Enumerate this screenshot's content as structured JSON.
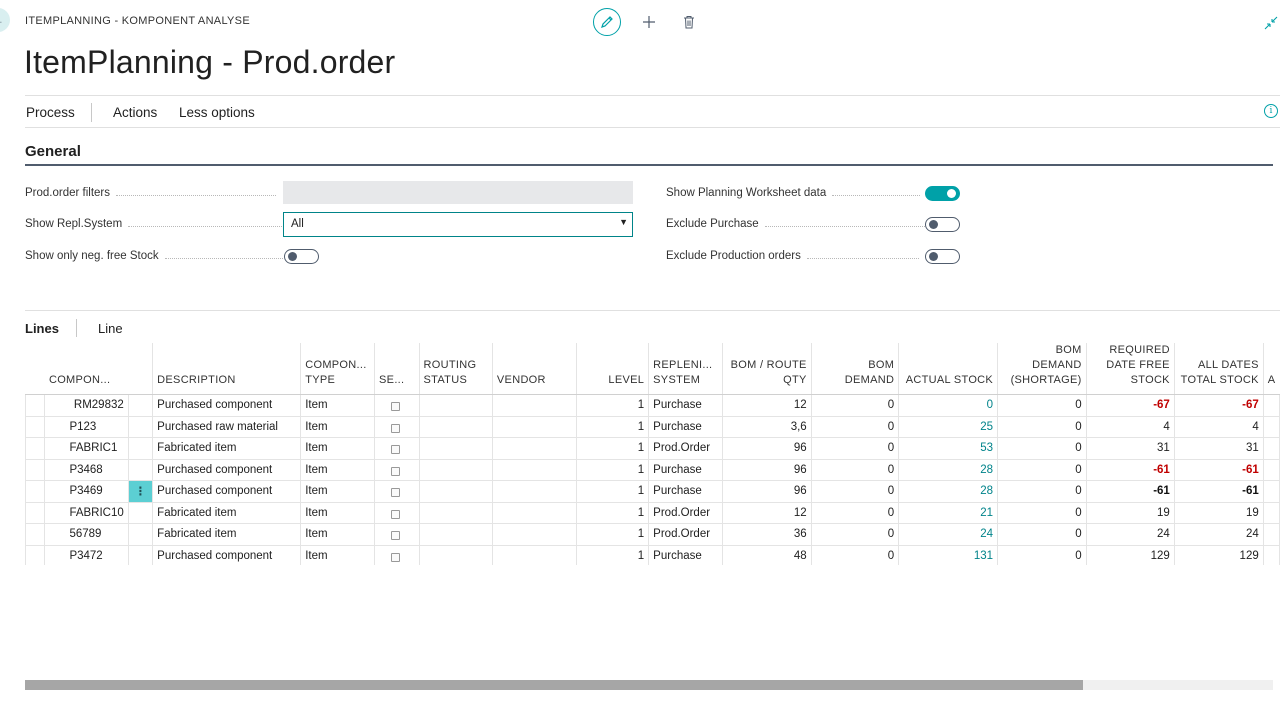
{
  "breadcrumb": "ITEMPLANNING - KOMPONENT ANALYSE",
  "page_title": "ItemPlanning - Prod.order",
  "action_bar": {
    "process": "Process",
    "actions": "Actions",
    "less_options": "Less options"
  },
  "general": {
    "title": "General",
    "prod_order_filters": {
      "label": "Prod.order filters",
      "value": ""
    },
    "show_repl_system": {
      "label": "Show Repl.System",
      "value": "All"
    },
    "show_only_neg_free_stock": {
      "label": "Show only neg. free Stock",
      "on": false
    },
    "show_planning_worksheet_data": {
      "label": "Show Planning Worksheet data",
      "on": true
    },
    "exclude_purchase": {
      "label": "Exclude Purchase",
      "on": false
    },
    "exclude_production_orders": {
      "label": "Exclude Production orders",
      "on": false
    }
  },
  "lines": {
    "tab_lines": "Lines",
    "tab_line": "Line",
    "headers": {
      "component": "COMPON...",
      "description": "DESCRIPTION",
      "component_type_1": "COMPON...",
      "component_type_2": "TYPE",
      "se": "SE...",
      "routing_status_1": "ROUTING",
      "routing_status_2": "STATUS",
      "vendor": "VENDOR",
      "level": "LEVEL",
      "replenishment_1": "REPLENI...",
      "replenishment_2": "SYSTEM",
      "bom_route_qty_1": "BOM / ROUTE",
      "bom_route_qty_2": "QTY",
      "bom_demand_1": "BOM",
      "bom_demand_2": "DEMAND",
      "actual_stock": "ACTUAL STOCK",
      "bom_shortage_1": "BOM",
      "bom_shortage_2": "DEMAND",
      "bom_shortage_3": "(SHORTAGE)",
      "required_1": "REQUIRED",
      "required_2": "DATE FREE",
      "required_3": "STOCK",
      "all_dates_1": "ALL DATES",
      "all_dates_2": "TOTAL STOCK",
      "more": "A"
    },
    "rows": [
      {
        "component": "RM29832",
        "description": "Purchased component",
        "type": "Item",
        "level": "1",
        "system": "Purchase",
        "qty": "12",
        "bom_demand": "0",
        "actual_stock": "0",
        "shortage": "0",
        "required": "-67",
        "all_dates": "-67"
      },
      {
        "component": "P123",
        "description": "Purchased raw material",
        "type": "Item",
        "level": "1",
        "system": "Purchase",
        "qty": "3,6",
        "bom_demand": "0",
        "actual_stock": "25",
        "shortage": "0",
        "required": "4",
        "all_dates": "4"
      },
      {
        "component": "FABRIC1",
        "description": "Fabricated item",
        "type": "Item",
        "level": "1",
        "system": "Prod.Order",
        "qty": "96",
        "bom_demand": "0",
        "actual_stock": "53",
        "shortage": "0",
        "required": "31",
        "all_dates": "31"
      },
      {
        "component": "P3468",
        "description": "Purchased component",
        "type": "Item",
        "level": "1",
        "system": "Purchase",
        "qty": "96",
        "bom_demand": "0",
        "actual_stock": "28",
        "shortage": "0",
        "required": "-61",
        "all_dates": "-61"
      },
      {
        "component": "P3469",
        "description": "Purchased component",
        "type": "Item",
        "level": "1",
        "system": "Purchase",
        "qty": "96",
        "bom_demand": "0",
        "actual_stock": "28",
        "shortage": "0",
        "required": "-61",
        "all_dates": "-61"
      },
      {
        "component": "FABRIC10",
        "description": "Fabricated item",
        "type": "Item",
        "level": "1",
        "system": "Prod.Order",
        "qty": "12",
        "bom_demand": "0",
        "actual_stock": "21",
        "shortage": "0",
        "required": "19",
        "all_dates": "19"
      },
      {
        "component": "56789",
        "description": "Fabricated item",
        "type": "Item",
        "level": "1",
        "system": "Prod.Order",
        "qty": "36",
        "bom_demand": "0",
        "actual_stock": "24",
        "shortage": "0",
        "required": "24",
        "all_dates": "24"
      },
      {
        "component": "P3472",
        "description": "Purchased component",
        "type": "Item",
        "level": "1",
        "system": "Purchase",
        "qty": "48",
        "bom_demand": "0",
        "actual_stock": "131",
        "shortage": "0",
        "required": "129",
        "all_dates": "129"
      }
    ]
  },
  "icons": {
    "back": "back-arrow-icon",
    "edit": "pencil-icon",
    "new": "plus-icon",
    "delete": "trash-icon",
    "collapse": "collapse-icon",
    "info": "info-icon",
    "row_menu": "ellipsis-vertical-icon"
  },
  "colors": {
    "accent": "#00a1a8",
    "negative": "#c00000",
    "link": "#00838a",
    "header_line": "#505c6d"
  }
}
